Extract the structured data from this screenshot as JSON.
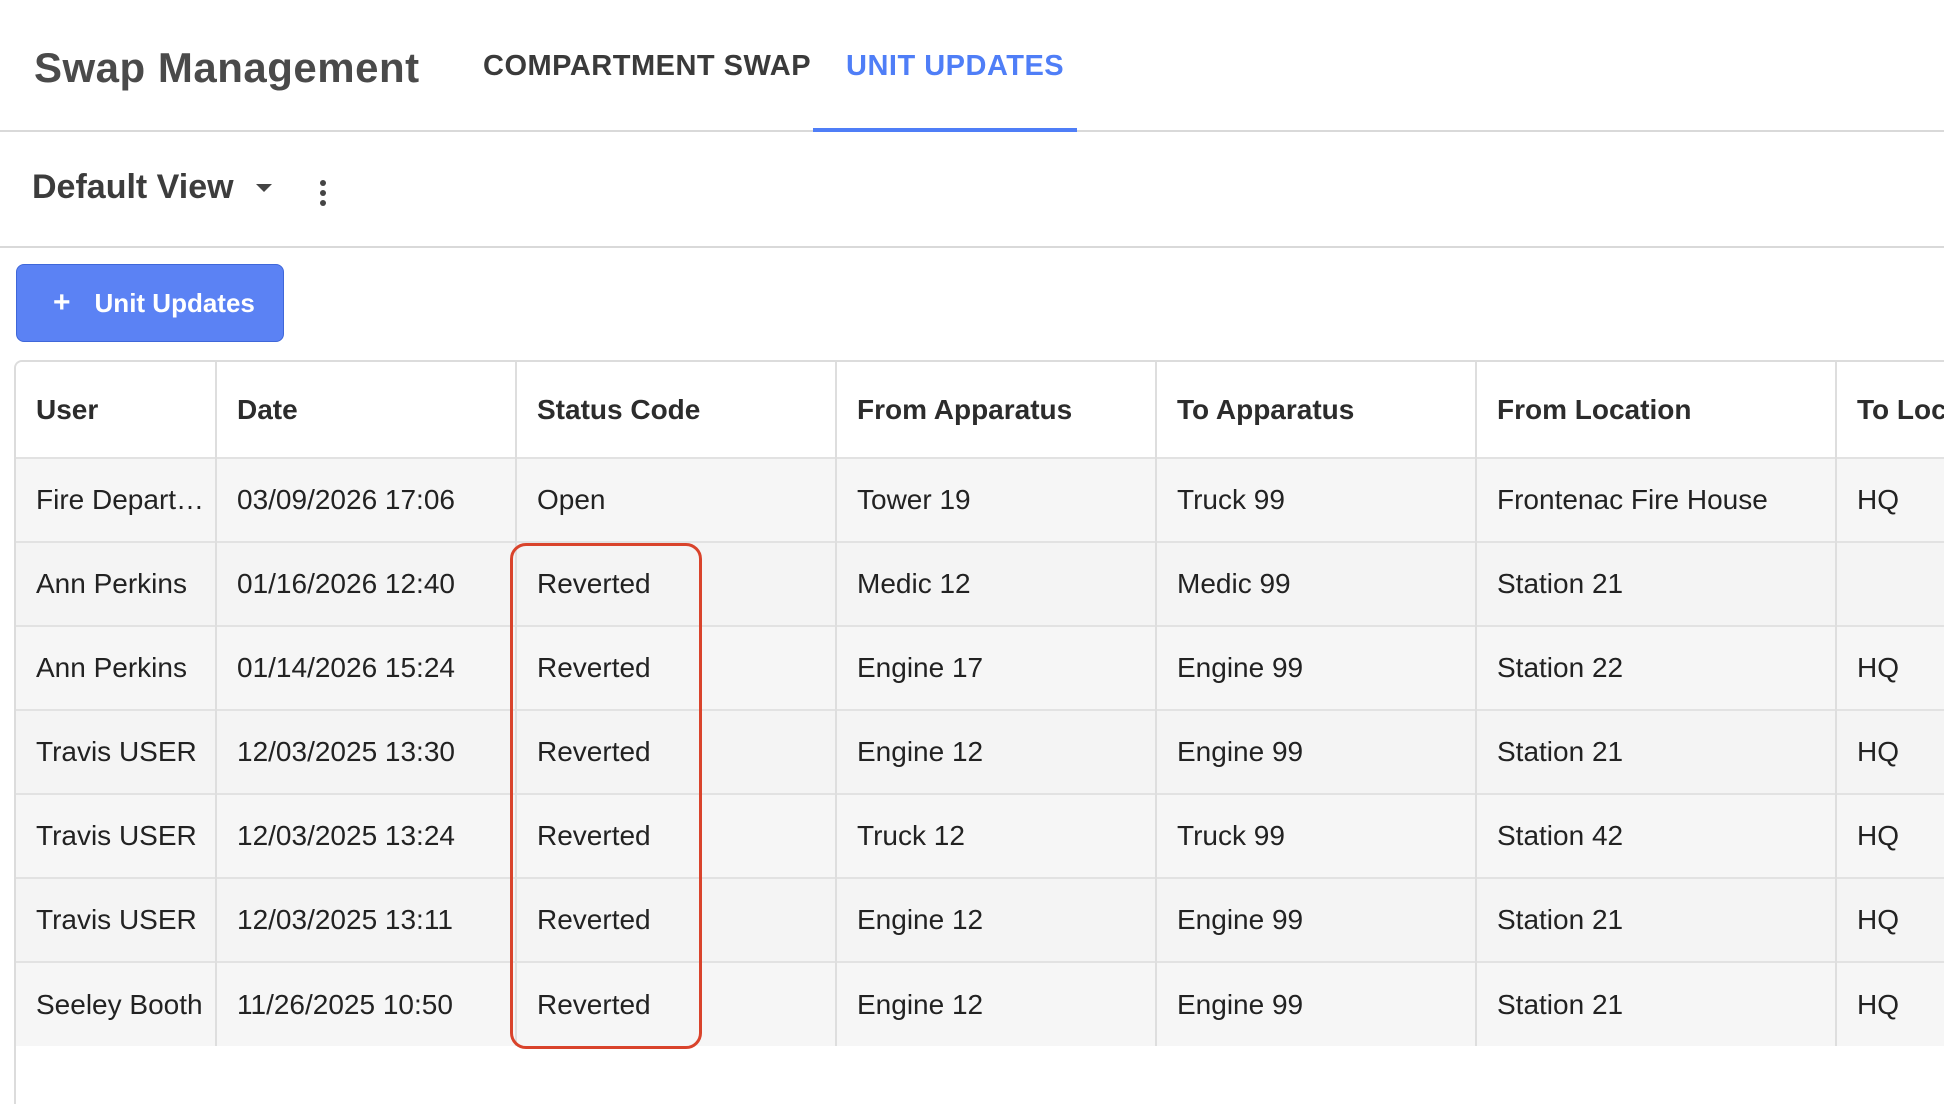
{
  "header": {
    "title": "Swap Management",
    "tabs": [
      {
        "label": "COMPARTMENT SWAP",
        "active": false
      },
      {
        "label": "UNIT UPDATES",
        "active": true
      }
    ]
  },
  "view": {
    "label": "Default View"
  },
  "add_button": {
    "icon": "+",
    "label": "Unit Updates"
  },
  "table": {
    "columns": [
      "User",
      "Date",
      "Status Code",
      "From Apparatus",
      "To Apparatus",
      "From Location",
      "To Location"
    ],
    "rows": [
      [
        "Fire Department",
        "03/09/2026 17:06",
        "Open",
        "Tower 19",
        "Truck 99",
        "Frontenac Fire House",
        "HQ"
      ],
      [
        "Ann Perkins",
        "01/16/2026 12:40",
        "Reverted",
        "Medic 12",
        "Medic 99",
        "Station 21",
        ""
      ],
      [
        "Ann Perkins",
        "01/14/2026 15:24",
        "Reverted",
        "Engine 17",
        "Engine 99",
        "Station 22",
        "HQ"
      ],
      [
        "Travis USER",
        "12/03/2025 13:30",
        "Reverted",
        "Engine 12",
        "Engine 99",
        "Station 21",
        "HQ"
      ],
      [
        "Travis USER",
        "12/03/2025 13:24",
        "Reverted",
        "Truck 12",
        "Truck 99",
        "Station 42",
        "HQ"
      ],
      [
        "Travis USER",
        "12/03/2025 13:11",
        "Reverted",
        "Engine 12",
        "Engine 99",
        "Station 21",
        "HQ"
      ],
      [
        "Seeley Booth",
        "11/26/2025 10:50",
        "Reverted",
        "Engine 12",
        "Engine 99",
        "Station 21",
        "HQ"
      ]
    ]
  },
  "colors": {
    "accent": "#4f7ef7",
    "button": "#5b82f4",
    "highlight": "#d9432b"
  },
  "icons": {
    "view_dropdown": "caret-down-icon",
    "view_menu": "kebab-menu-icon",
    "add": "plus-icon"
  }
}
